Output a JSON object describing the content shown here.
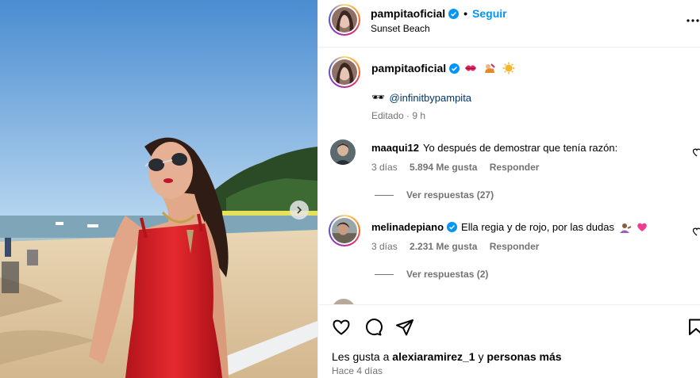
{
  "post": {
    "username": "pampitaoficial",
    "follow_label": "Seguir",
    "separator": "•",
    "location": "Sunset Beach"
  },
  "caption": {
    "username": "pampitaoficial",
    "emojis": [
      "kiss-icon",
      "woman-getting-massage-icon",
      "sun-icon"
    ],
    "sunglasses": "🕶",
    "mention": "@infinitbypampita",
    "meta": "Editado · 9 h"
  },
  "comments": [
    {
      "username": "maaqui12",
      "text": "Yo después de demostrar que tenía razón:",
      "time": "3 días",
      "likes": "5.894 Me gusta",
      "reply": "Responder",
      "view_replies": "Ver respuestas (27)"
    },
    {
      "username": "melinadepiano",
      "text": "Ella regia y de rojo, por las dudas",
      "time": "3 días",
      "likes": "2.231 Me gusta",
      "reply": "Responder",
      "view_replies": "Ver respuestas (2)"
    }
  ],
  "footer": {
    "likes_prefix": "Les gusta a",
    "likes_user": "alexiaramirez_1",
    "likes_mid": "y",
    "likes_others": "personas más",
    "time": "Hace 4 días"
  },
  "colors": {
    "link": "#0095f6",
    "mention": "#00376b",
    "secondary": "#737373"
  }
}
